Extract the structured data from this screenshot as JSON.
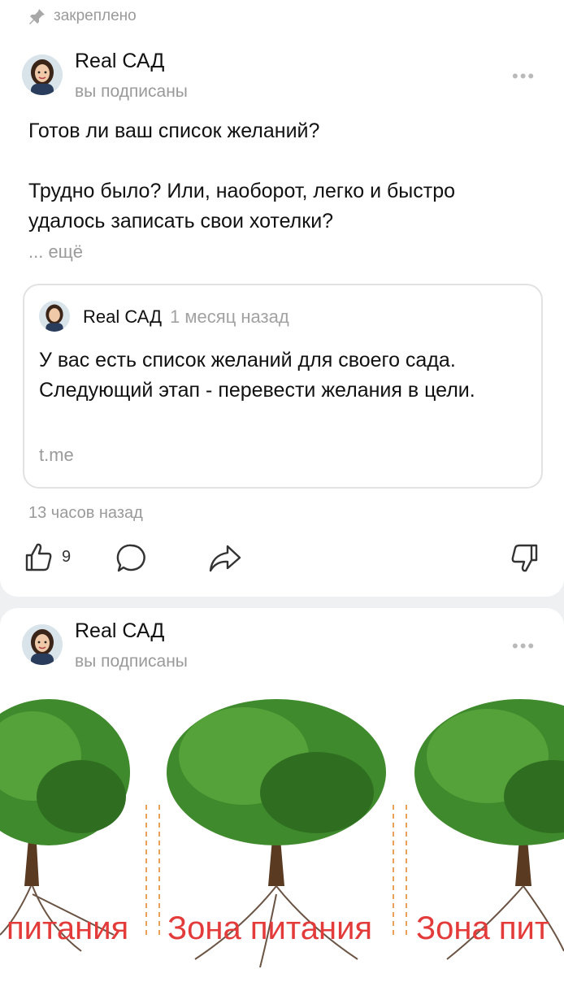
{
  "pinned_label": "закреплено",
  "post1": {
    "author": "Real САД",
    "subtitle": "вы подписаны",
    "text": "Готов ли ваш список желаний?\n\nТрудно было? Или, наоборот, легко и быстро удалось записать свои хотелки?",
    "more": "... ещё",
    "repost": {
      "author": "Real САД",
      "time": "1 месяц назад",
      "text": "У вас есть список желаний для своего сада. Следующий этап - перевести желания в цели.",
      "link": "t.me"
    },
    "timestamp": "13 часов назад",
    "like_count": "9"
  },
  "post2": {
    "author": "Real САД",
    "subtitle": "вы подписаны",
    "image_labels": [
      "питания",
      "Зона питания",
      "Зона пит"
    ]
  },
  "menu_dots": "•••",
  "colors": {
    "accent_red": "#e33a3a",
    "muted": "#9a9a9a",
    "tree_green": "#3f8a2c"
  }
}
